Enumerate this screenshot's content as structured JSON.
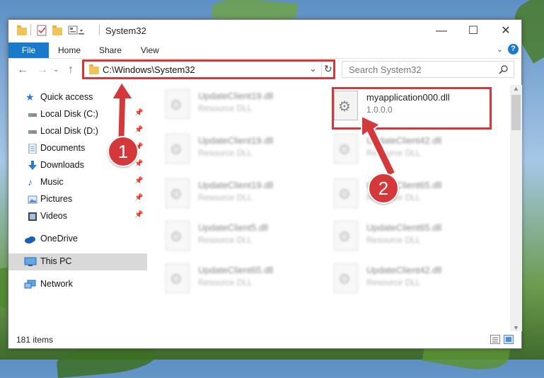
{
  "window": {
    "title": "System32",
    "minimize_glyph": "—",
    "maximize_glyph": "☐",
    "close_glyph": "✕"
  },
  "ribbon": {
    "tabs": [
      "File",
      "Home",
      "Share",
      "View"
    ],
    "help_glyph": "?",
    "expand_glyph": "⌄"
  },
  "navigation": {
    "back_glyph": "←",
    "forward_glyph": "→",
    "up_glyph": "↑",
    "address": "C:\\Windows\\System32",
    "address_dropdown_glyph": "⌄",
    "refresh_glyph": "↻",
    "search_placeholder": "Search System32"
  },
  "sidebar": {
    "quick_access": "Quick access",
    "items": [
      {
        "label": "Local Disk (C:)",
        "icon": "drive-icon",
        "pinned": true
      },
      {
        "label": "Local Disk (D:)",
        "icon": "drive-icon",
        "pinned": true
      },
      {
        "label": "Documents",
        "icon": "documents-icon",
        "pinned": true
      },
      {
        "label": "Downloads",
        "icon": "downloads-icon",
        "pinned": true
      },
      {
        "label": "Music",
        "icon": "music-icon",
        "pinned": true
      },
      {
        "label": "Pictures",
        "icon": "pictures-icon",
        "pinned": true
      },
      {
        "label": "Videos",
        "icon": "videos-icon",
        "pinned": true
      }
    ],
    "onedrive": "OneDrive",
    "this_pc": "This PC",
    "network": "Network",
    "pin_glyph": "📌"
  },
  "files": {
    "highlighted": {
      "name": "myapplication000.dll",
      "version": "1.0.0.0"
    },
    "left_column": [
      {
        "name": "UpdateClient19.dll",
        "type": "Resource DLL"
      },
      {
        "name": "UpdateClient19.dll",
        "type": "Resource DLL"
      },
      {
        "name": "UpdateClient19.dll",
        "type": "Resource DLL"
      },
      {
        "name": "UpdateClient5.dll",
        "type": "Resource DLL"
      },
      {
        "name": "UpdateClient65.dll",
        "type": "Resource DLL"
      }
    ],
    "right_column": [
      {
        "name": "UpdateClient42.dll",
        "type": "Resource DLL"
      },
      {
        "name": "UpdateClient65.dll",
        "type": "Resource DLL"
      },
      {
        "name": "UpdateClient65.dll",
        "type": "Resource DLL"
      },
      {
        "name": "UpdateClient42.dll",
        "type": "Resource DLL"
      }
    ]
  },
  "status": {
    "items": "181 items"
  },
  "annotations": {
    "step1": "1",
    "step2": "2",
    "color": "#d3393b"
  },
  "colors": {
    "accent": "#1979ca",
    "highlight": "#d3393b"
  }
}
